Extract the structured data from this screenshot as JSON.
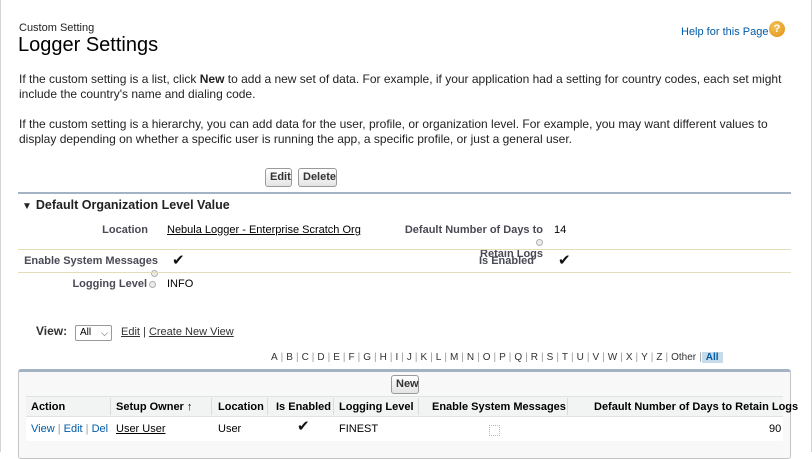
{
  "header": {
    "eyebrow": "Custom Setting",
    "title": "Logger Settings",
    "help_link": "Help for this Page",
    "help_icon_glyph": "?"
  },
  "description": {
    "p1_before": "If the custom setting is a list, click ",
    "p1_bold": "New",
    "p1_after": " to add a new set of data. For example, if your application had a setting for country codes, each set might include the country's name and dialing code.",
    "p2": "If the custom setting is a hierarchy, you can add data for the user, profile, or organization level. For example, you may want different values to display depending on whether a specific user is running the app, a specific profile, or just a general user."
  },
  "toolbar": {
    "edit_label": "Edit",
    "delete_label": "Delete"
  },
  "org_section": {
    "title": "Default Organization Level Value",
    "collapse_glyph": "▼",
    "location_label": "Location",
    "location_value": "Nebula Logger - Enterprise Scratch Org",
    "days_label_line1": "Default Number of Days to",
    "days_label_line2": "Retain Logs",
    "days_value": "14",
    "system_messages_label": "Enable System Messages",
    "system_messages_checked": true,
    "is_enabled_label": "Is Enabled",
    "is_enabled_checked": true,
    "logging_level_label": "Logging Level",
    "logging_level_value": "INFO",
    "check_glyph": "✔"
  },
  "view": {
    "label": "View:",
    "selected": "All",
    "chevron_glyph": "⌵",
    "edit_link": "Edit",
    "divider": "|",
    "create_link": "Create New View"
  },
  "alphabet": {
    "letters": [
      "A",
      "B",
      "C",
      "D",
      "E",
      "F",
      "G",
      "H",
      "I",
      "J",
      "K",
      "L",
      "M",
      "N",
      "O",
      "P",
      "Q",
      "R",
      "S",
      "T",
      "U",
      "V",
      "W",
      "X",
      "Y",
      "Z",
      "Other",
      "All"
    ],
    "active": "All",
    "separator": "|"
  },
  "list": {
    "new_label": "New",
    "columns": {
      "action": "Action",
      "setup_owner": "Setup Owner",
      "sort_glyph": "↑",
      "location": "Location",
      "is_enabled": "Is Enabled",
      "logging_level": "Logging Level",
      "system_messages": "Enable System Messages",
      "days": "Default Number of Days to Retain Logs"
    },
    "rows": [
      {
        "view_link": "View",
        "edit_link": "Edit",
        "del_link": "Del",
        "sep": "|",
        "setup_owner": "User User",
        "location": "User",
        "is_enabled": true,
        "logging_level": "FINEST",
        "system_messages": false,
        "days": "90"
      }
    ]
  },
  "colors": {
    "link": "#015ba7",
    "section_rule": "#a4b3c3",
    "row_rule": "#e3deb8",
    "help_icon": "#e08f10"
  },
  "icons": {
    "help": "help-circle-icon",
    "field_help": "info-dot-icon",
    "checkmark": "checkmark-icon",
    "collapse": "triangle-down-icon"
  }
}
